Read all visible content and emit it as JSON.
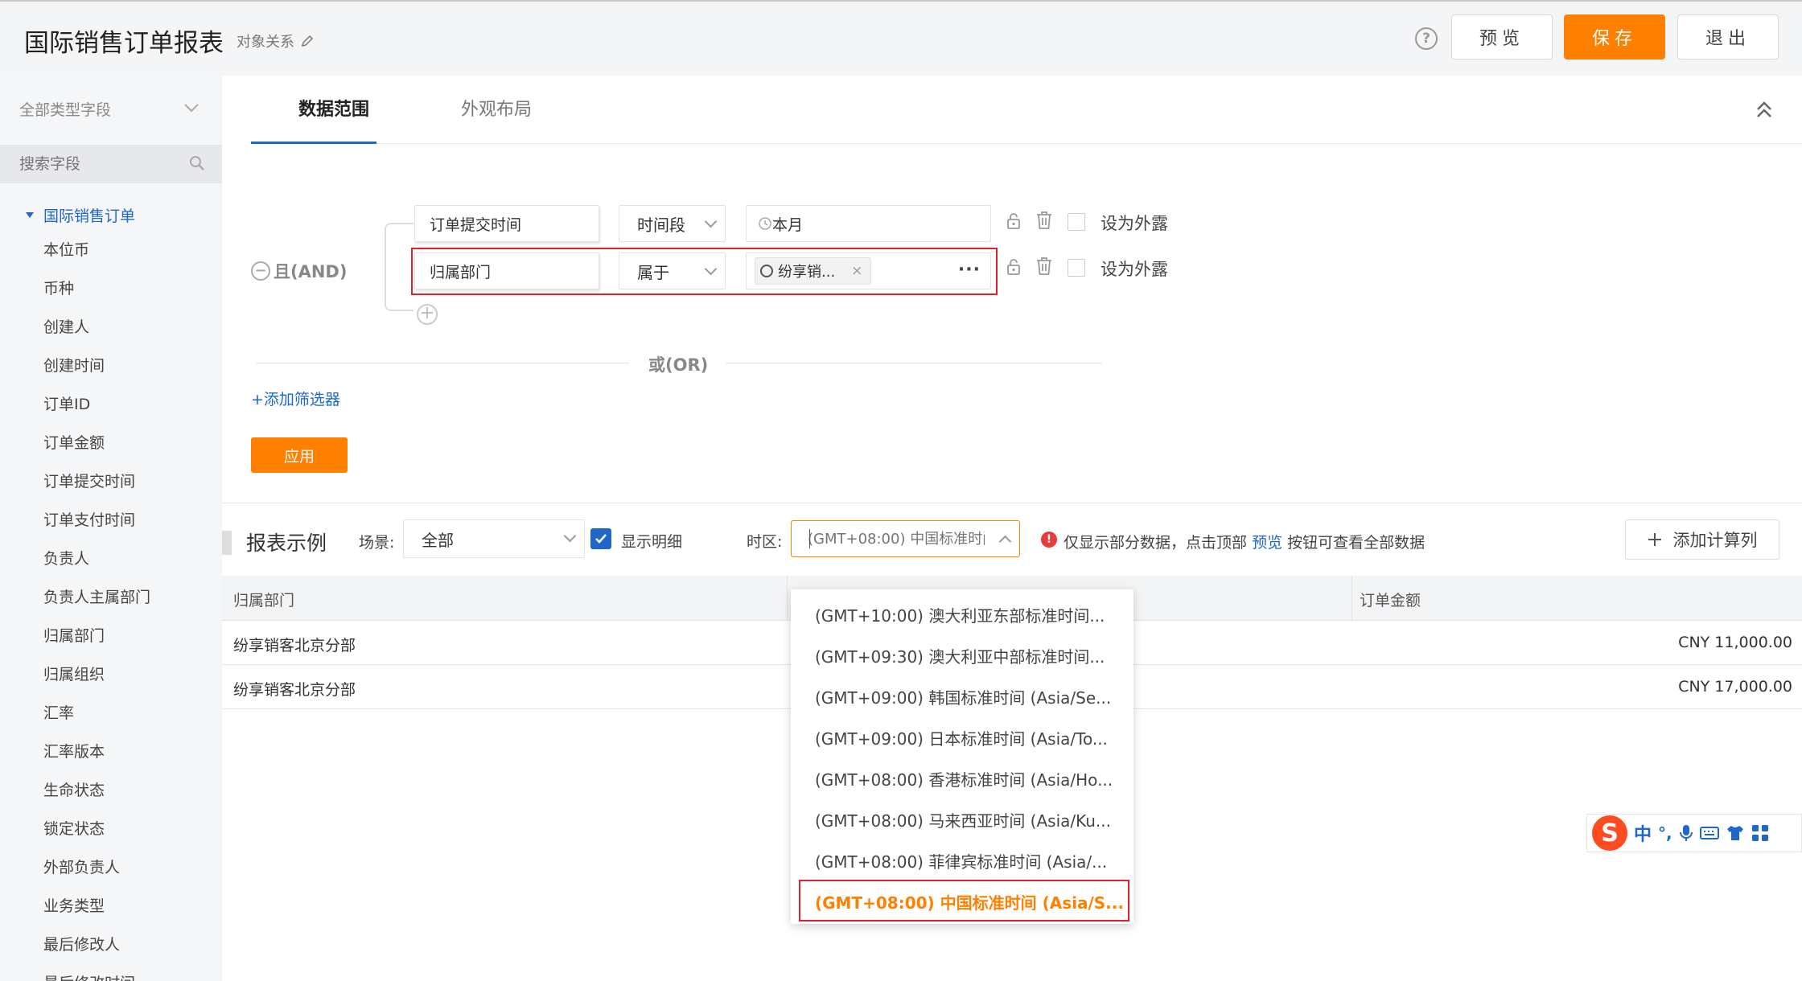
{
  "header": {
    "title": "国际销售订单报表",
    "object_relation": "对象关系",
    "preview": "预览",
    "save": "保存",
    "exit": "退出",
    "help": "?"
  },
  "sidebar": {
    "field_type": "全部类型字段",
    "search_placeholder": "搜索字段",
    "root": "国际销售订单",
    "fields": [
      "本位币",
      "币种",
      "创建人",
      "创建时间",
      "订单ID",
      "订单金额",
      "订单提交时间",
      "订单支付时间",
      "负责人",
      "负责人主属部门",
      "归属部门",
      "归属组织",
      "汇率",
      "汇率版本",
      "生命状态",
      "锁定状态",
      "外部负责人",
      "业务类型",
      "最后修改人",
      "最后修改时间"
    ]
  },
  "tabs": [
    "数据范围",
    "外观布局"
  ],
  "filters": {
    "and_label": "且(AND)",
    "or_label": "或(OR)",
    "rows": [
      {
        "field": "订单提交时间",
        "operator": "时间段",
        "value": "本月",
        "expose": "设为外露"
      },
      {
        "field": "归属部门",
        "operator": "属于",
        "value": "纷享销...",
        "expose": "设为外露"
      }
    ],
    "add_filter": "+添加筛选器",
    "apply": "应用"
  },
  "report": {
    "title": "报表示例",
    "scene_label": "场景:",
    "scene_value": "全部",
    "show_detail": "显示明细",
    "timezone_label": "时区:",
    "timezone_value": "(GMT+08:00) 中国标准时间",
    "notice_before": "仅显示部分数据，点击顶部",
    "notice_link": "预览",
    "notice_after": "按钮可查看全部数据",
    "add_calc": "添加计算列"
  },
  "table": {
    "columns": [
      "归属部门",
      "订单金额"
    ],
    "rows": [
      {
        "dept": "纷享销客北京分部",
        "amount": "CNY 11,000.00"
      },
      {
        "dept": "纷享销客北京分部",
        "amount": "CNY 17,000.00"
      }
    ]
  },
  "timezone_dropdown": [
    "(GMT+10:00) 澳大利亚东部标准时间...",
    "(GMT+09:30) 澳大利亚中部标准时间...",
    "(GMT+09:00) 韩国标准时间 (Asia/Se...",
    "(GMT+09:00) 日本标准时间 (Asia/To...",
    "(GMT+08:00) 香港标准时间 (Asia/Ho...",
    "(GMT+08:00) 马来西亚时间 (Asia/Ku...",
    "(GMT+08:00) 菲律宾标准时间 (Asia/...",
    "(GMT+08:00) 中国标准时间 (Asia/S..."
  ],
  "ime": {
    "logo": "S",
    "lang": "中",
    "punct": "°,"
  },
  "colors": {
    "accent": "#ff8000",
    "link": "#1f67c8",
    "highlight": "#e0202a"
  }
}
